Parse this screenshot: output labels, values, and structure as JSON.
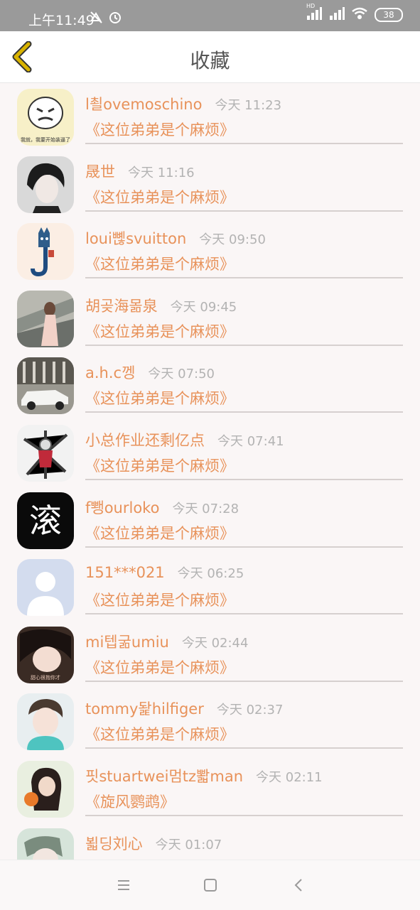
{
  "status": {
    "time": "上午11:49",
    "battery": "38",
    "hd": "HD"
  },
  "header": {
    "title": "收藏"
  },
  "favorites": [
    {
      "name": "l쵤ovemoschino",
      "time": "今天 11:23",
      "book": "《这位弟弟是个麻烦》",
      "avatar_text": "我就，我要开始装逼了"
    },
    {
      "name": "晟世",
      "time": "今天 11:16",
      "book": "《这位弟弟是个麻烦》"
    },
    {
      "name": "loui뼪svuitton",
      "time": "今天 09:50",
      "book": "《这位弟弟是个麻烦》"
    },
    {
      "name": "胡곶海몲泉",
      "time": "今天 09:45",
      "book": "《这位弟弟是个麻烦》"
    },
    {
      "name": "a.h.c껭",
      "time": "今天 07:50",
      "book": "《这位弟弟是个麻烦》"
    },
    {
      "name": "小总作业还剩亿点",
      "time": "今天 07:41",
      "book": "《这位弟弟是个麻烦》"
    },
    {
      "name": "f뾍ourloko",
      "time": "今天 07:28",
      "book": "《这位弟弟是个麻烦》",
      "avatar_text": "滚"
    },
    {
      "name": "151***021",
      "time": "今天 06:25",
      "book": "《这位弟弟是个麻烦》"
    },
    {
      "name": "mi텝굶umiu",
      "time": "今天 02:44",
      "book": "《这位弟弟是个麻烦》",
      "avatar_text": "甜心很抱你才"
    },
    {
      "name": "tommy돭hilfiger",
      "time": "今天 02:37",
      "book": "《这位弟弟是个麻烦》"
    },
    {
      "name": "핏stuartwei멈tz뽧man",
      "time": "今天 02:11",
      "book": "《旋风鹦鹉》"
    },
    {
      "name": "뵓딩刘心",
      "time": "今天 01:07",
      "book": ""
    }
  ],
  "colors": {
    "accent": "#e8925a",
    "back_arrow": "#d9b300",
    "status_bg": "#9a9a9a"
  }
}
